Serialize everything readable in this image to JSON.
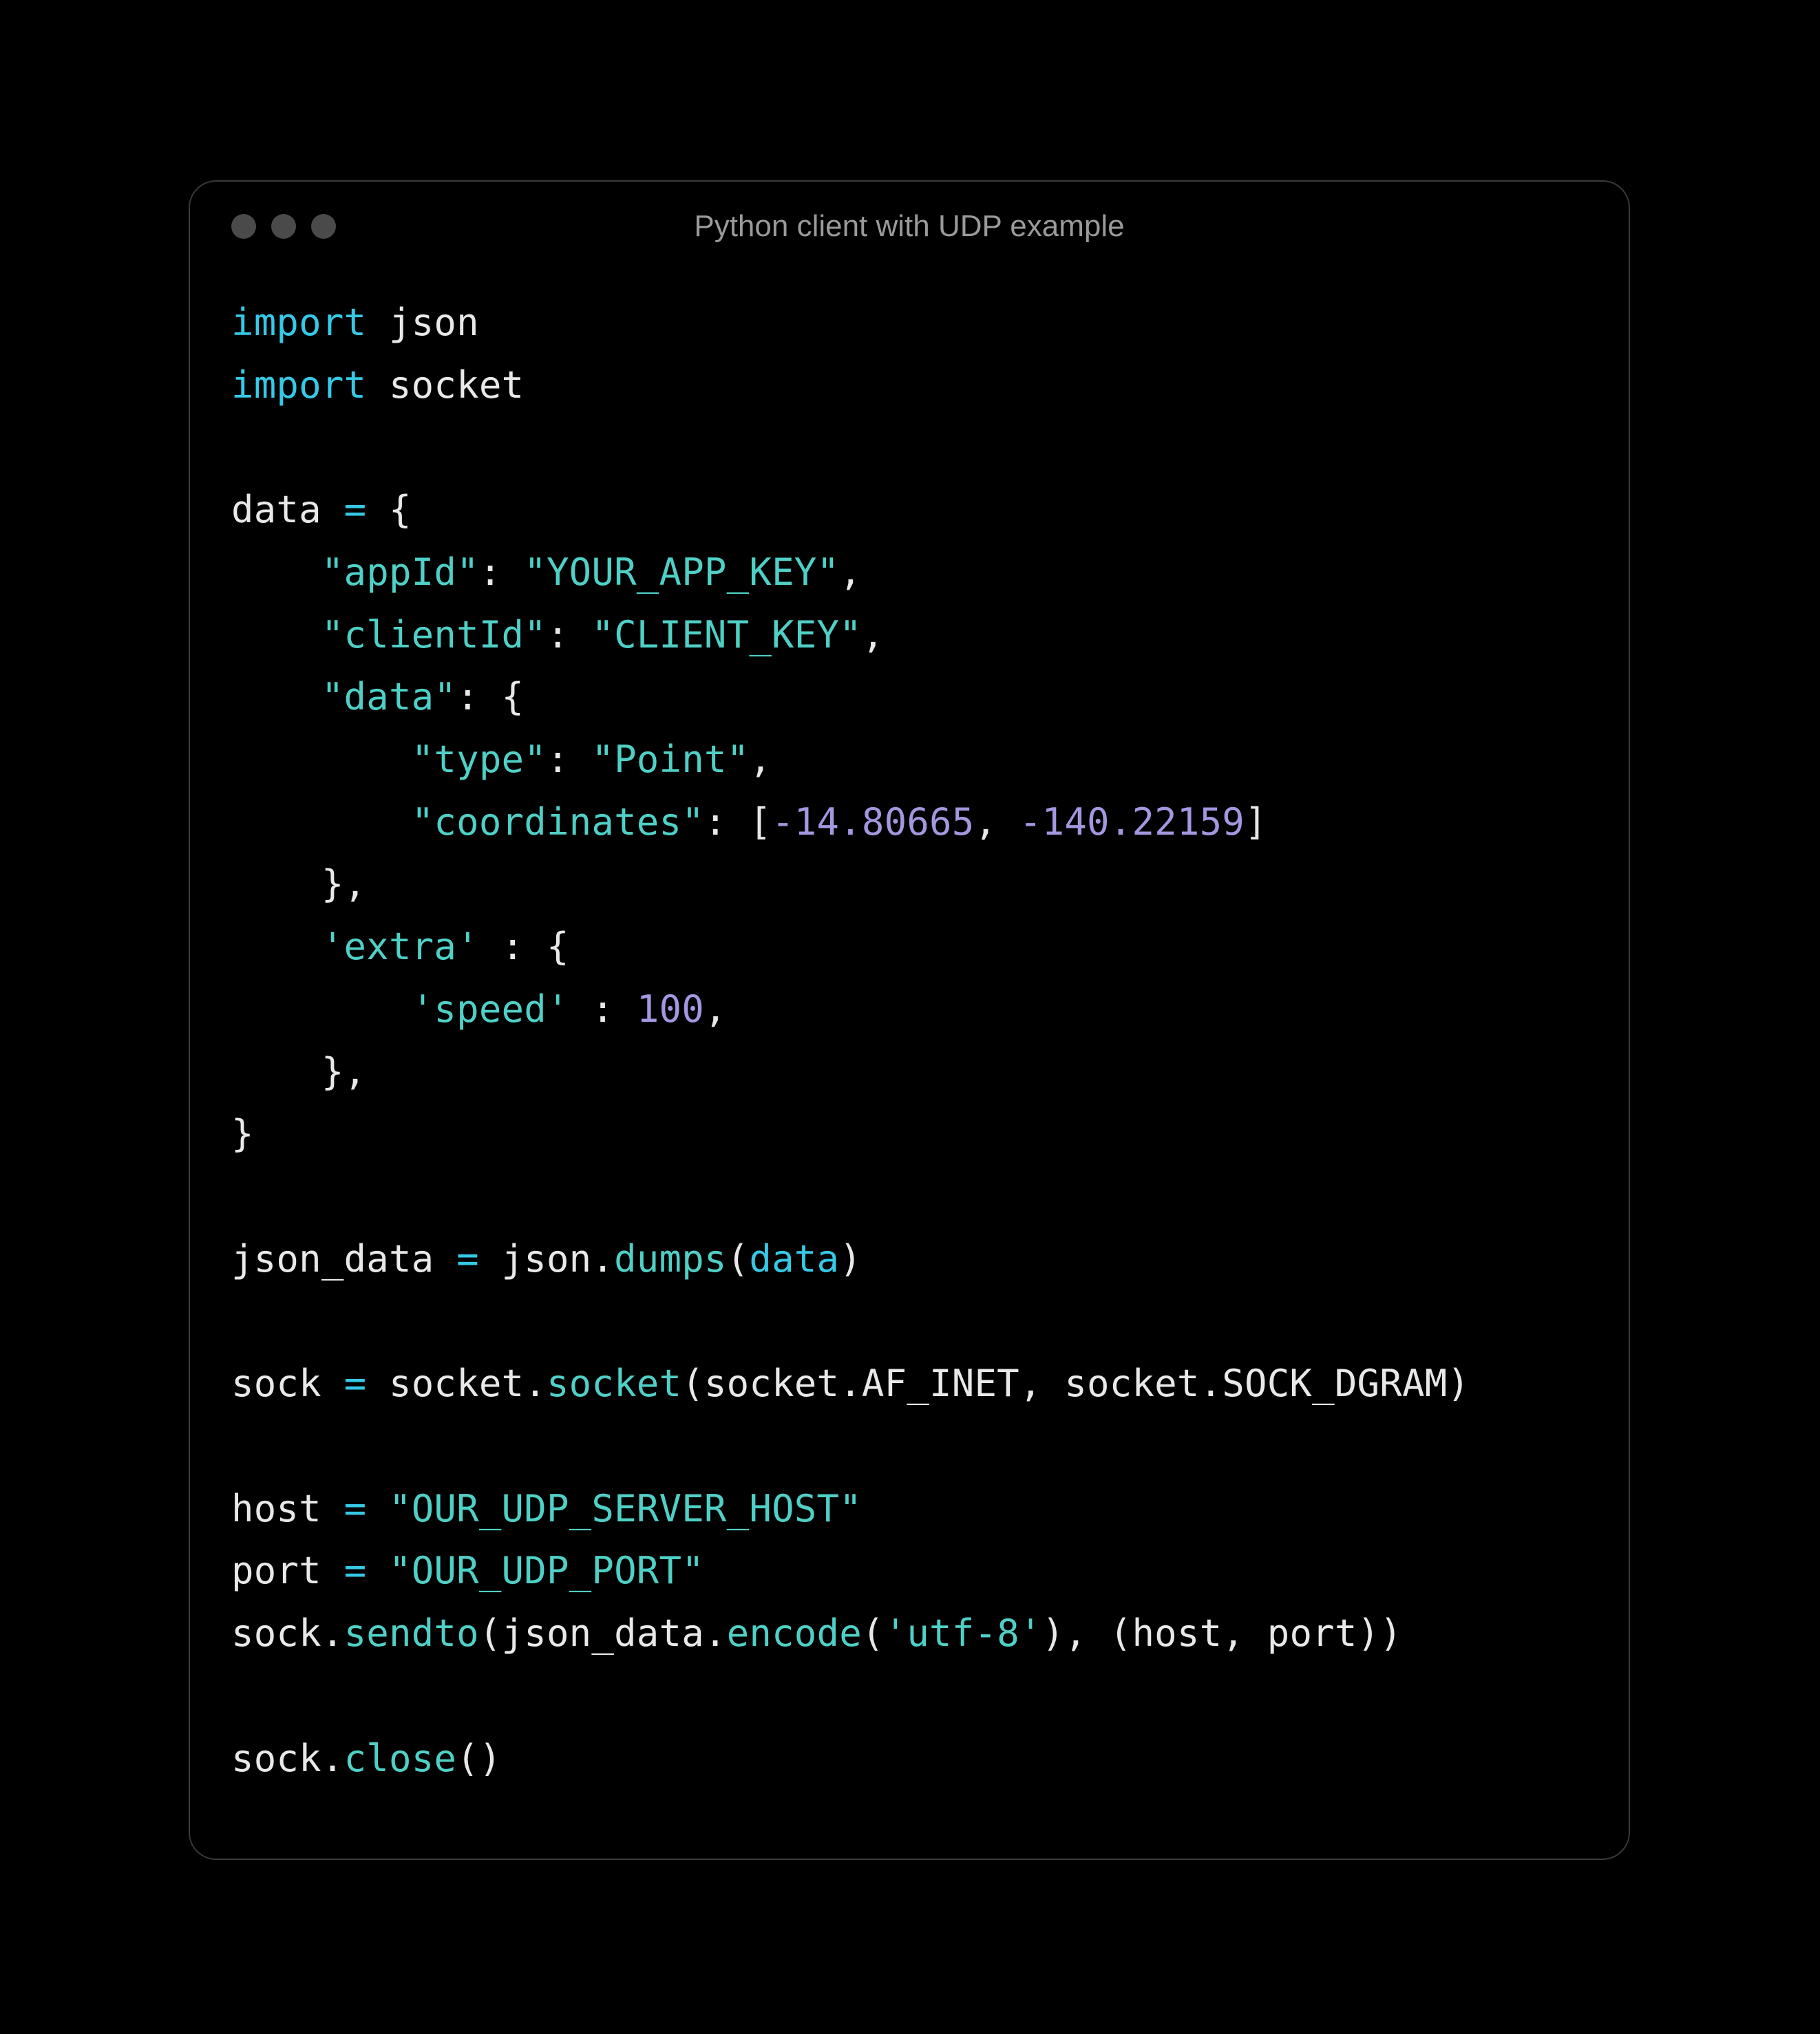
{
  "window": {
    "title": "Python client with UDP example"
  },
  "code": {
    "l1_import": "import",
    "l1_mod": " json",
    "l2_import": "import",
    "l2_mod": " socket",
    "blank": "",
    "l4_var": "data ",
    "l4_eq": "= ",
    "l4_brace": "{",
    "l5_indent": "    ",
    "l5_key": "\"appId\"",
    "l5_colon": ": ",
    "l5_val": "\"YOUR_APP_KEY\"",
    "l5_comma": ",",
    "l6_indent": "    ",
    "l6_key": "\"clientId\"",
    "l6_colon": ": ",
    "l6_val": "\"CLIENT_KEY\"",
    "l6_comma": ",",
    "l7_indent": "    ",
    "l7_key": "\"data\"",
    "l7_rest": ": {",
    "l8_indent": "        ",
    "l8_key": "\"type\"",
    "l8_colon": ": ",
    "l8_val": "\"Point\"",
    "l8_comma": ",",
    "l9_indent": "        ",
    "l9_key": "\"coordinates\"",
    "l9_colon": ": [",
    "l9_n1": "-14.80665",
    "l9_sep": ", ",
    "l9_n2": "-140.22159",
    "l9_close": "]",
    "l10": "    },",
    "l11_indent": "    ",
    "l11_key": "'extra'",
    "l11_rest": " : {",
    "l12_indent": "        ",
    "l12_key": "'speed'",
    "l12_colon": " : ",
    "l12_val": "100",
    "l12_comma": ",",
    "l13": "    },",
    "l14": "}",
    "l16_a": "json_data ",
    "l16_eq": "= ",
    "l16_b": "json.",
    "l16_fun": "dumps",
    "l16_c": "(",
    "l16_arg": "data",
    "l16_d": ")",
    "l18_a": "sock ",
    "l18_eq": "= ",
    "l18_b": "socket.",
    "l18_fun": "socket",
    "l18_c": "(socket.AF_INET, socket.SOCK_DGRAM)",
    "l20_a": "host ",
    "l20_eq": "= ",
    "l20_val": "\"OUR_UDP_SERVER_HOST\"",
    "l21_a": "port ",
    "l21_eq": "= ",
    "l21_val": "\"OUR_UDP_PORT\"",
    "l22_a": "sock.",
    "l22_fun": "sendto",
    "l22_b": "(json_data.",
    "l22_fun2": "encode",
    "l22_c": "(",
    "l22_enc": "'utf-8'",
    "l22_d": "), (host, port))",
    "l24_a": "sock.",
    "l24_fun": "close",
    "l24_b": "()"
  }
}
